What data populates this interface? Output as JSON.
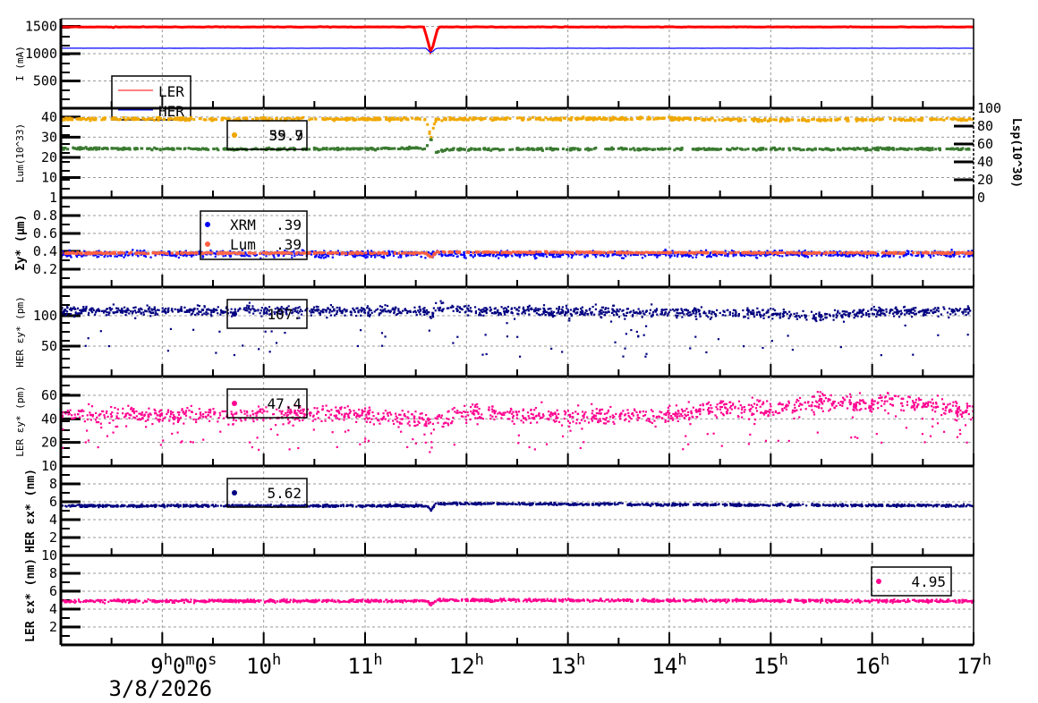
{
  "chart_data": [
    {
      "type": "line",
      "ylabel": "I (mA)",
      "ylim": [
        0,
        1640
      ],
      "yticks": [
        500,
        1000,
        1500
      ],
      "legend": {
        "position": "left",
        "entries": [
          {
            "label": "LER",
            "color": "#ff0000"
          },
          {
            "label": "HER",
            "color": "#0000ff"
          }
        ]
      },
      "series": [
        {
          "name": "LER",
          "color": "#ff0000",
          "kind": "line",
          "noise": 3,
          "points": [
            [
              8,
              1490
            ],
            [
              8.5,
              1490
            ],
            [
              8.51,
              1440
            ],
            [
              8.52,
              1490
            ],
            [
              11.58,
              1490
            ],
            [
              11.65,
              1010
            ],
            [
              11.72,
              1490
            ],
            [
              17,
              1490
            ]
          ]
        },
        {
          "name": "HER",
          "color": "#0000ff",
          "kind": "line",
          "noise": 1,
          "points": [
            [
              8,
              1100
            ],
            [
              11.6,
              1100
            ],
            [
              11.65,
              1010
            ],
            [
              11.7,
              1100
            ],
            [
              17,
              1100
            ]
          ]
        }
      ]
    },
    {
      "type": "scatter",
      "ylabel": "Lum(10^33)",
      "ylim": [
        0,
        44.4
      ],
      "yticks": [
        10,
        20,
        30,
        40
      ],
      "y2label": "Lsp(10^30)",
      "y2lim": [
        0,
        100
      ],
      "y2ticks": [
        0,
        20,
        40,
        60,
        80,
        100
      ],
      "legend": {
        "position": "left",
        "entries": [
          {
            "label": "39.7",
            "color": "#f0a800"
          },
          {
            "label": "55.9",
            "color": "#3a7a30"
          }
        ]
      },
      "series": [
        {
          "name": "Lum",
          "color": "#f0a800",
          "kind": "dense",
          "noise": 0.5,
          "points": [
            [
              8,
              39
            ],
            [
              11.6,
              39
            ],
            [
              11.65,
              30
            ],
            [
              11.7,
              39
            ],
            [
              14,
              39.3
            ],
            [
              15,
              38.5
            ],
            [
              17,
              38.8
            ]
          ]
        },
        {
          "name": "Lsp",
          "color": "#3a7a30",
          "kind": "dense",
          "noise": 0.4,
          "points": [
            [
              8,
              24.5
            ],
            [
              10,
              24
            ],
            [
              11.6,
              24.5
            ],
            [
              11.65,
              29
            ],
            [
              11.7,
              22.5
            ],
            [
              11.8,
              24
            ],
            [
              17,
              24.2
            ]
          ]
        }
      ]
    },
    {
      "type": "scatter",
      "ylabel": "Σy* (µm)",
      "ylim": [
        0,
        1
      ],
      "yticks": [
        0.2,
        0.4,
        0.6,
        0.8,
        1
      ],
      "legend": {
        "position": "left",
        "entries": [
          {
            "label": "XRM",
            "value": ".39",
            "color": "#0000ff"
          },
          {
            "label": "Lum",
            "value": ".39",
            "color": "#ff6040"
          }
        ]
      },
      "series": [
        {
          "name": "XRM",
          "color": "#0000ff",
          "kind": "scatter",
          "noise": 0.025,
          "points": [
            [
              8,
              0.37
            ],
            [
              17,
              0.37
            ]
          ]
        },
        {
          "name": "Lum",
          "color": "#ff6040",
          "kind": "dense",
          "noise": 0.006,
          "points": [
            [
              8,
              0.38
            ],
            [
              11.6,
              0.38
            ],
            [
              11.65,
              0.33
            ],
            [
              11.7,
              0.39
            ],
            [
              17,
              0.38
            ]
          ]
        }
      ]
    },
    {
      "type": "scatter",
      "ylabel": "HER εy* (pm)",
      "ylim": [
        0,
        147
      ],
      "yticks": [
        50,
        100
      ],
      "legend": {
        "position": "left",
        "entries": [
          {
            "label": "107.",
            "color": "#000080"
          }
        ]
      },
      "series": [
        {
          "name": "HER eps_y",
          "color": "#000080",
          "kind": "scatter",
          "noise": 6,
          "outliers": 0.04,
          "points": [
            [
              8,
              108
            ],
            [
              11.6,
              108
            ],
            [
              11.65,
              95
            ],
            [
              11.7,
              115
            ],
            [
              12,
              108
            ],
            [
              15,
              104
            ],
            [
              15.5,
              98
            ],
            [
              16,
              106
            ],
            [
              17,
              108
            ]
          ]
        }
      ]
    },
    {
      "type": "scatter",
      "ylabel": "LER εy* (pm)",
      "ylim": [
        0,
        76
      ],
      "yticks": [
        20,
        40,
        60
      ],
      "legend": {
        "position": "left",
        "entries": [
          {
            "label": "47.4",
            "color": "#ff0090"
          }
        ]
      },
      "series": [
        {
          "name": "LER eps_y",
          "color": "#ff0090",
          "kind": "scatter",
          "noise": 5,
          "outliers": 0.08,
          "points": [
            [
              8,
              44
            ],
            [
              11,
              44
            ],
            [
              11.65,
              38
            ],
            [
              12,
              46
            ],
            [
              13,
              42
            ],
            [
              14,
              43
            ],
            [
              14.6,
              50
            ],
            [
              15,
              48
            ],
            [
              15.5,
              55
            ],
            [
              16,
              52
            ],
            [
              16.2,
              56
            ],
            [
              17,
              46
            ]
          ]
        }
      ]
    },
    {
      "type": "scatter",
      "ylabel": "HER εx* (nm)",
      "ylim": [
        0,
        10
      ],
      "yticks": [
        2,
        4,
        6,
        8,
        10
      ],
      "legend": {
        "position": "left",
        "entries": [
          {
            "label": "5.62",
            "color": "#000080"
          }
        ]
      },
      "series": [
        {
          "name": "HER eps_x",
          "color": "#000080",
          "kind": "scatter",
          "noise": 0.1,
          "points": [
            [
              8,
              5.55
            ],
            [
              11.6,
              5.55
            ],
            [
              11.65,
              5.1
            ],
            [
              11.7,
              5.8
            ],
            [
              17,
              5.55
            ]
          ]
        }
      ]
    },
    {
      "type": "scatter",
      "ylabel": "LER εx* (nm)",
      "ylim": [
        0,
        10
      ],
      "yticks": [
        2,
        4,
        6,
        8,
        10
      ],
      "legend": {
        "position": "right",
        "entries": [
          {
            "label": "4.95",
            "color": "#ff0090"
          }
        ]
      },
      "series": [
        {
          "name": "LER eps_x",
          "color": "#ff0090",
          "kind": "scatter",
          "noise": 0.12,
          "points": [
            [
              8,
              4.9
            ],
            [
              11.6,
              4.9
            ],
            [
              11.65,
              4.5
            ],
            [
              11.7,
              5.0
            ],
            [
              17,
              4.9
            ]
          ]
        }
      ]
    }
  ],
  "x_axis": {
    "range_hours": [
      8,
      17
    ],
    "ticks": [
      {
        "h": 9,
        "label": "9",
        "sup": "h",
        "extra": "0",
        "sup2": "m",
        "extra2": "0",
        "sup3": "s"
      },
      {
        "h": 10,
        "label": "10",
        "sup": "h"
      },
      {
        "h": 11,
        "label": "11",
        "sup": "h"
      },
      {
        "h": 12,
        "label": "12",
        "sup": "h"
      },
      {
        "h": 13,
        "label": "13",
        "sup": "h"
      },
      {
        "h": 14,
        "label": "14",
        "sup": "h"
      },
      {
        "h": 15,
        "label": "15",
        "sup": "h"
      },
      {
        "h": 16,
        "label": "16",
        "sup": "h"
      },
      {
        "h": 17,
        "label": "17",
        "sup": "h"
      }
    ],
    "date": "3/8/2026"
  }
}
